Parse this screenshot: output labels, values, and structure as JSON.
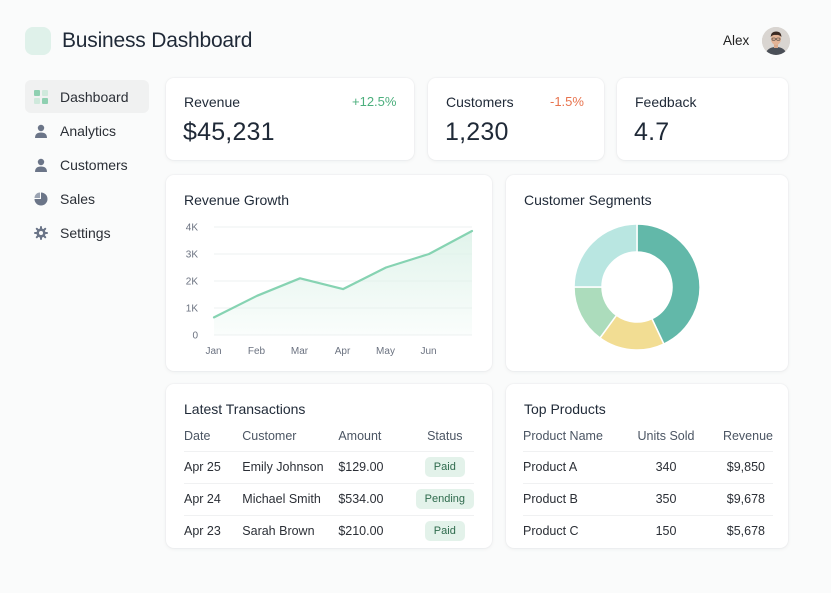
{
  "header": {
    "title": "Business Dashboard",
    "user_name": "Alex"
  },
  "sidebar": {
    "items": [
      {
        "label": "Dashboard",
        "icon": "grid-icon",
        "active": true
      },
      {
        "label": "Analytics",
        "icon": "user-icon",
        "active": false
      },
      {
        "label": "Customers",
        "icon": "user-icon",
        "active": false
      },
      {
        "label": "Sales",
        "icon": "pie-icon",
        "active": false
      },
      {
        "label": "Settings",
        "icon": "gear-icon",
        "active": false
      }
    ]
  },
  "kpis": [
    {
      "label": "Revenue",
      "value": "$45,231",
      "delta": "+12.5%",
      "delta_color": "#4caf7d"
    },
    {
      "label": "Customers",
      "value": "1,230",
      "delta": "-1.5%",
      "delta_color": "#e8744f"
    },
    {
      "label": "Feedback",
      "value": "4.7",
      "delta": ""
    }
  ],
  "revenue_growth": {
    "title": "Revenue Growth"
  },
  "customer_segments": {
    "title": "Customer Segments"
  },
  "chart_data": [
    {
      "type": "area",
      "title": "Revenue Growth",
      "categories": [
        "Jan",
        "Feb",
        "Mar",
        "Apr",
        "May",
        "Jun"
      ],
      "x_tick_labels": [
        "Jan",
        "Feb",
        "Mar",
        "Apr",
        "May",
        "Jun"
      ],
      "y_tick_labels": [
        "0",
        "1K",
        "2K",
        "3K",
        "4K"
      ],
      "points": [
        {
          "x": 0,
          "y": 650
        },
        {
          "x": 1,
          "y": 1450
        },
        {
          "x": 2,
          "y": 2100
        },
        {
          "x": 3,
          "y": 1700
        },
        {
          "x": 4,
          "y": 2500
        },
        {
          "x": 5,
          "y": 3000
        },
        {
          "x": 6,
          "y": 3850
        }
      ],
      "ylim": [
        0,
        4000
      ],
      "grid": true,
      "line_color": "#86d3b2",
      "fill_color": "#dff3ea"
    },
    {
      "type": "pie",
      "title": "Customer Segments",
      "donut": true,
      "slices": [
        {
          "value": 43,
          "color": "#62b8a9"
        },
        {
          "value": 17,
          "color": "#f2dd93"
        },
        {
          "value": 15,
          "color": "#acdcbc"
        },
        {
          "value": 25,
          "color": "#b9e6e1"
        }
      ]
    }
  ],
  "transactions": {
    "title": "Latest Transactions",
    "columns": [
      "Date",
      "Customer",
      "Amount",
      "Status"
    ],
    "rows": [
      {
        "date": "Apr 25",
        "customer": "Emily Johnson",
        "amount": "$129.00",
        "status": "Paid"
      },
      {
        "date": "Apr 24",
        "customer": "Michael Smith",
        "amount": "$534.00",
        "status": "Pending"
      },
      {
        "date": "Apr 23",
        "customer": "Sarah Brown",
        "amount": "$210.00",
        "status": "Paid"
      }
    ]
  },
  "top_products": {
    "title": "Top Products",
    "columns": [
      "Product Name",
      "Units Sold",
      "Revenue"
    ],
    "rows": [
      {
        "name": "Product A",
        "units": "340",
        "revenue": "$9,850"
      },
      {
        "name": "Product B",
        "units": "350",
        "revenue": "$9,678"
      },
      {
        "name": "Product C",
        "units": "150",
        "revenue": "$5,678"
      }
    ]
  },
  "colors": {
    "accent": "#62b8a9",
    "positive": "#4caf7d",
    "negative": "#e8744f"
  }
}
